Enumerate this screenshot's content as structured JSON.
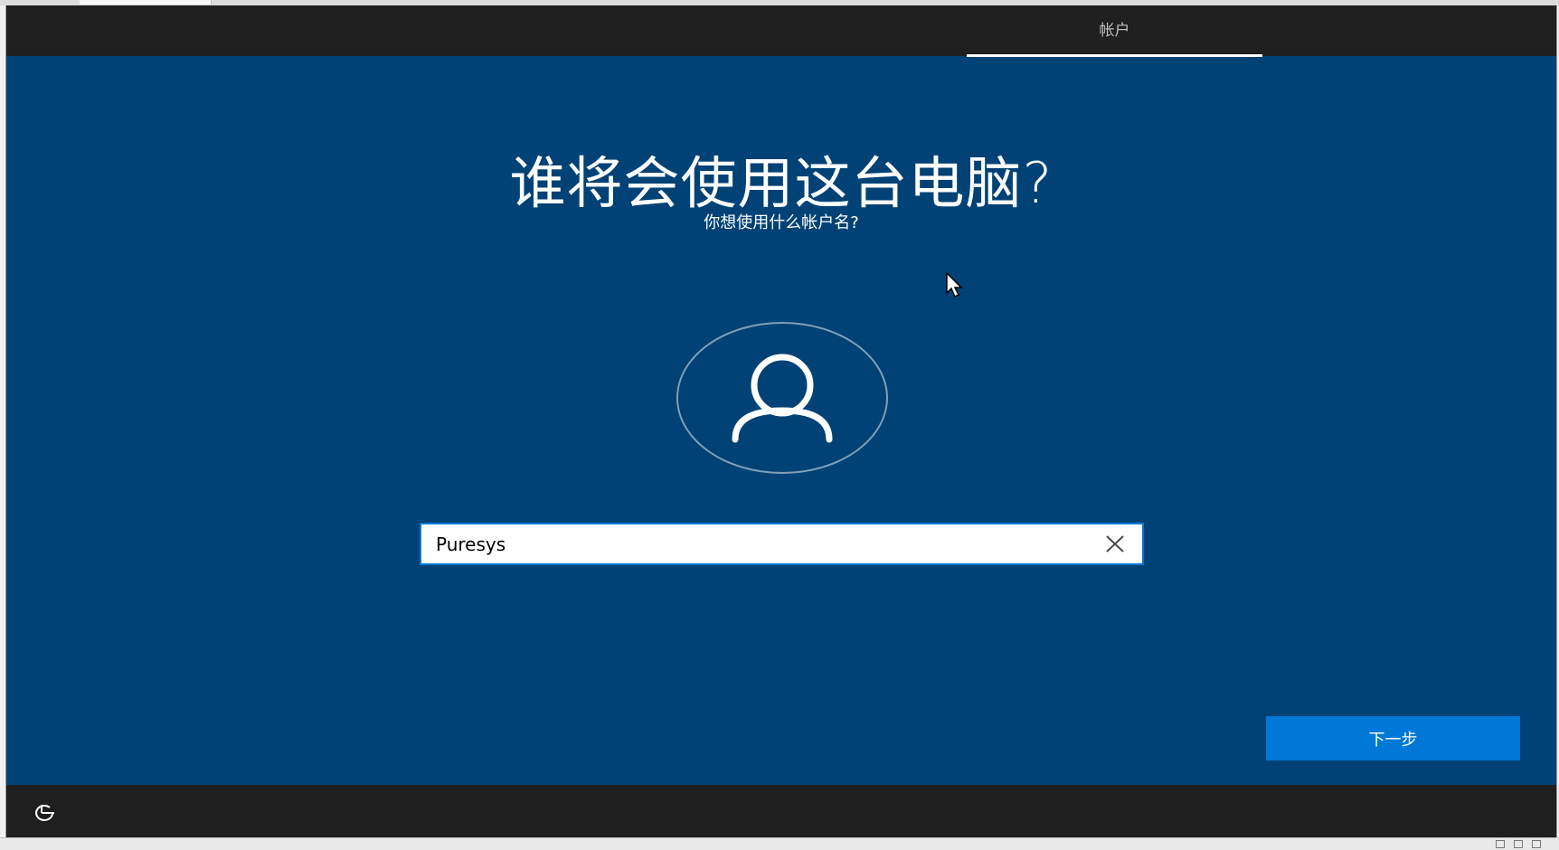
{
  "header": {
    "active_tab_label": "帐户"
  },
  "main": {
    "title": "谁将会使用这台电脑?",
    "subtitle": "你想使用什么帐户名?"
  },
  "username_field": {
    "value": "Puresys"
  },
  "buttons": {
    "next_label": "下一步"
  },
  "icons": {
    "avatar": "user-icon",
    "clear": "close-icon",
    "accessibility": "ease-of-access-icon",
    "cursor": "mouse-pointer-icon"
  },
  "colors": {
    "background": "#004275",
    "top_bar": "#1f1f1f",
    "accent": "#0078d7",
    "text": "#ffffff"
  }
}
